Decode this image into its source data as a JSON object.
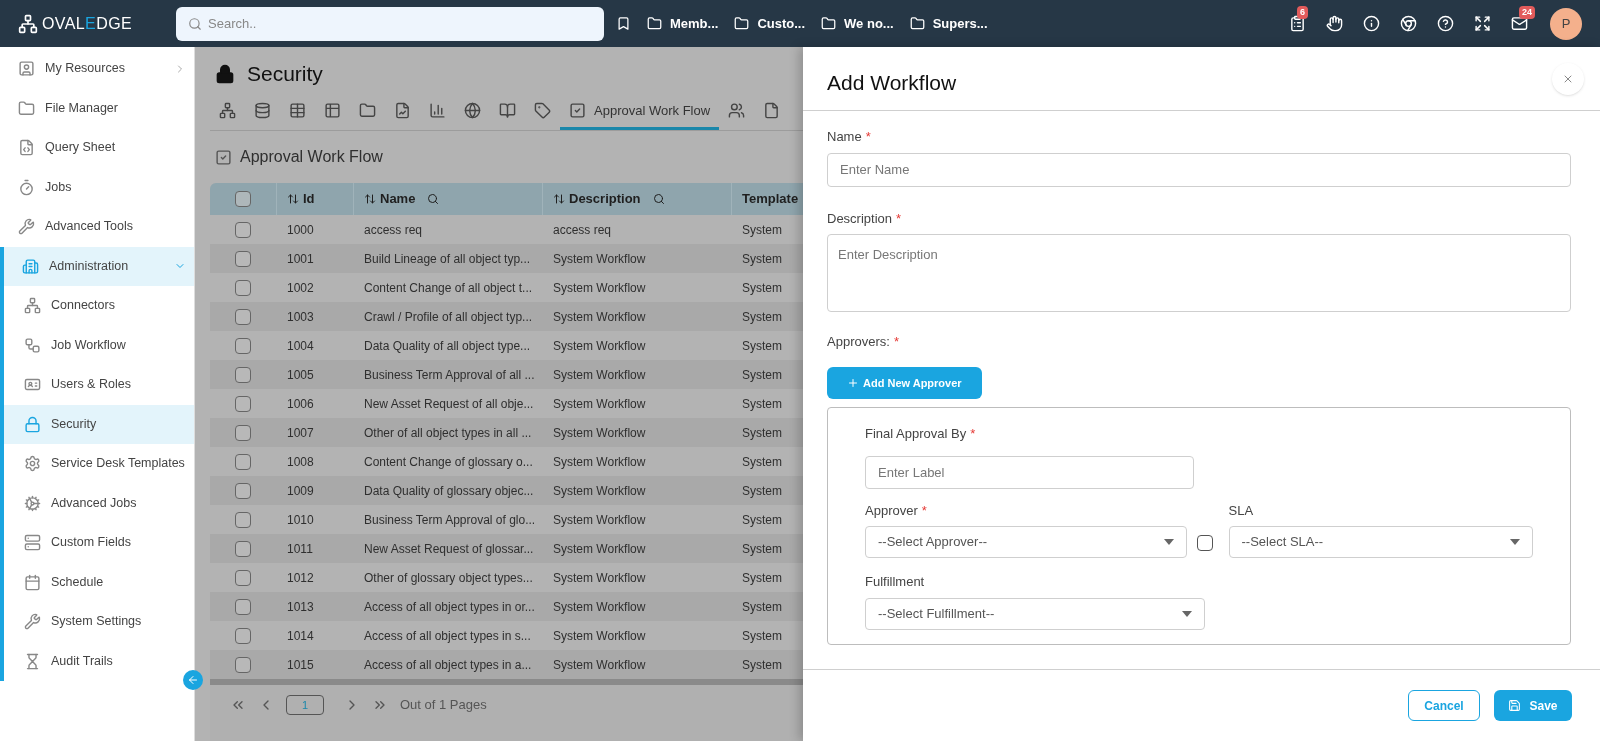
{
  "top_bar": {
    "logo": {
      "part_1": "OVAL",
      "part_2": "E",
      "part_3": "DGE"
    },
    "search": {
      "placeholder": "Search.."
    },
    "bookmarks": [
      "Memb...",
      "Custo...",
      "We no...",
      "Supers..."
    ],
    "icons": [
      {
        "kind": "tasks",
        "badge": "6"
      },
      {
        "kind": "hand"
      },
      {
        "kind": "info"
      },
      {
        "kind": "browser"
      },
      {
        "kind": "help"
      },
      {
        "kind": "expand"
      },
      {
        "kind": "mail",
        "badge": "24"
      }
    ],
    "avatar": "P"
  },
  "sidebar": {
    "items": [
      {
        "label": "My Resources",
        "selected": false,
        "expanded": false
      },
      {
        "label": "File Manager",
        "selected": false
      },
      {
        "label": "Query Sheet",
        "selected": false
      },
      {
        "label": "Jobs",
        "selected": false
      },
      {
        "label": "Advanced Tools",
        "selected": false
      },
      {
        "label": "Administration",
        "selected": true,
        "expanded": true,
        "children": [
          {
            "label": "Connectors",
            "selected": false
          },
          {
            "label": "Job Workflow",
            "selected": false
          },
          {
            "label": "Users & Roles",
            "selected": false
          },
          {
            "label": "Security",
            "selected": true
          },
          {
            "label": "Service Desk Templates",
            "selected": false
          },
          {
            "label": "Advanced Jobs",
            "selected": false
          },
          {
            "label": "Custom Fields",
            "selected": false
          },
          {
            "label": "Schedule",
            "selected": false
          },
          {
            "label": "System Settings",
            "selected": false
          },
          {
            "label": "Audit Trails",
            "selected": false
          }
        ]
      }
    ]
  },
  "page": {
    "title": "Security",
    "tabs": [
      {
        "selected": false
      },
      {
        "selected": false
      },
      {
        "selected": false
      },
      {
        "selected": false
      },
      {
        "selected": false
      },
      {
        "selected": false
      },
      {
        "selected": false
      },
      {
        "selected": false
      },
      {
        "selected": false
      },
      {
        "selected": false
      },
      {
        "label": "Approval Work Flow",
        "selected": true
      },
      {
        "selected": false
      },
      {
        "selected": false
      }
    ],
    "section_title": "Approval Work Flow",
    "table": {
      "all_checked": false,
      "columns": [
        "Id",
        "Name",
        "Description",
        "Template"
      ],
      "rows": [
        {
          "checked": false,
          "cells": [
            "1000",
            "access req",
            "access req",
            "System"
          ]
        },
        {
          "checked": false,
          "cells": [
            "1001",
            "Build Lineage of all object typ...",
            "System Workflow",
            "System"
          ]
        },
        {
          "checked": false,
          "cells": [
            "1002",
            "Content Change of all object t...",
            "System Workflow",
            "System"
          ]
        },
        {
          "checked": false,
          "cells": [
            "1003",
            "Crawl / Profile of all object typ...",
            "System Workflow",
            "System"
          ]
        },
        {
          "checked": false,
          "cells": [
            "1004",
            "Data Quality of all object type...",
            "System Workflow",
            "System"
          ]
        },
        {
          "checked": false,
          "cells": [
            "1005",
            "Business Term Approval of all ...",
            "System Workflow",
            "System"
          ]
        },
        {
          "checked": false,
          "cells": [
            "1006",
            "New Asset Request of all obje...",
            "System Workflow",
            "System"
          ]
        },
        {
          "checked": false,
          "cells": [
            "1007",
            "Other of all object types in all ...",
            "System Workflow",
            "System"
          ]
        },
        {
          "checked": false,
          "cells": [
            "1008",
            "Content Change of glossary o...",
            "System Workflow",
            "System"
          ]
        },
        {
          "checked": false,
          "cells": [
            "1009",
            "Data Quality of glossary objec...",
            "System Workflow",
            "System"
          ]
        },
        {
          "checked": false,
          "cells": [
            "1010",
            "Business Term Approval of glo...",
            "System Workflow",
            "System"
          ]
        },
        {
          "checked": false,
          "cells": [
            "1011",
            "New Asset Request of glossar...",
            "System Workflow",
            "System"
          ]
        },
        {
          "checked": false,
          "cells": [
            "1012",
            "Other of glossary object types...",
            "System Workflow",
            "System"
          ]
        },
        {
          "checked": false,
          "cells": [
            "1013",
            "Access of all object types in or...",
            "System Workflow",
            "System"
          ]
        },
        {
          "checked": false,
          "cells": [
            "1014",
            "Access of all object types in s...",
            "System Workflow",
            "System"
          ]
        },
        {
          "checked": false,
          "cells": [
            "1015",
            "Access of all object types in a...",
            "System Workflow",
            "System"
          ]
        }
      ]
    },
    "pagination": {
      "page": "1",
      "summary": "Out of 1 Pages"
    }
  },
  "drawer": {
    "title": "Add Workflow",
    "name": {
      "label": "Name",
      "required": "*",
      "placeholder": "Enter Name"
    },
    "description": {
      "label": "Description",
      "required": "*",
      "placeholder": "Enter Description"
    },
    "approvers": {
      "label": "Approvers:",
      "required": "*",
      "add_button": "Add New Approver",
      "final_approval": {
        "label": "Final Approval By",
        "required": "*",
        "placeholder": "Enter Label"
      },
      "approver": {
        "label": "Approver",
        "required": "*",
        "value": "--Select Approver--",
        "checked": false
      },
      "sla": {
        "label": "SLA",
        "value": "--Select SLA--"
      },
      "fulfillment": {
        "label": "Fulfillment",
        "value": "--Select Fulfillment--"
      }
    },
    "buttons": {
      "cancel": "Cancel",
      "save": "Save"
    }
  }
}
